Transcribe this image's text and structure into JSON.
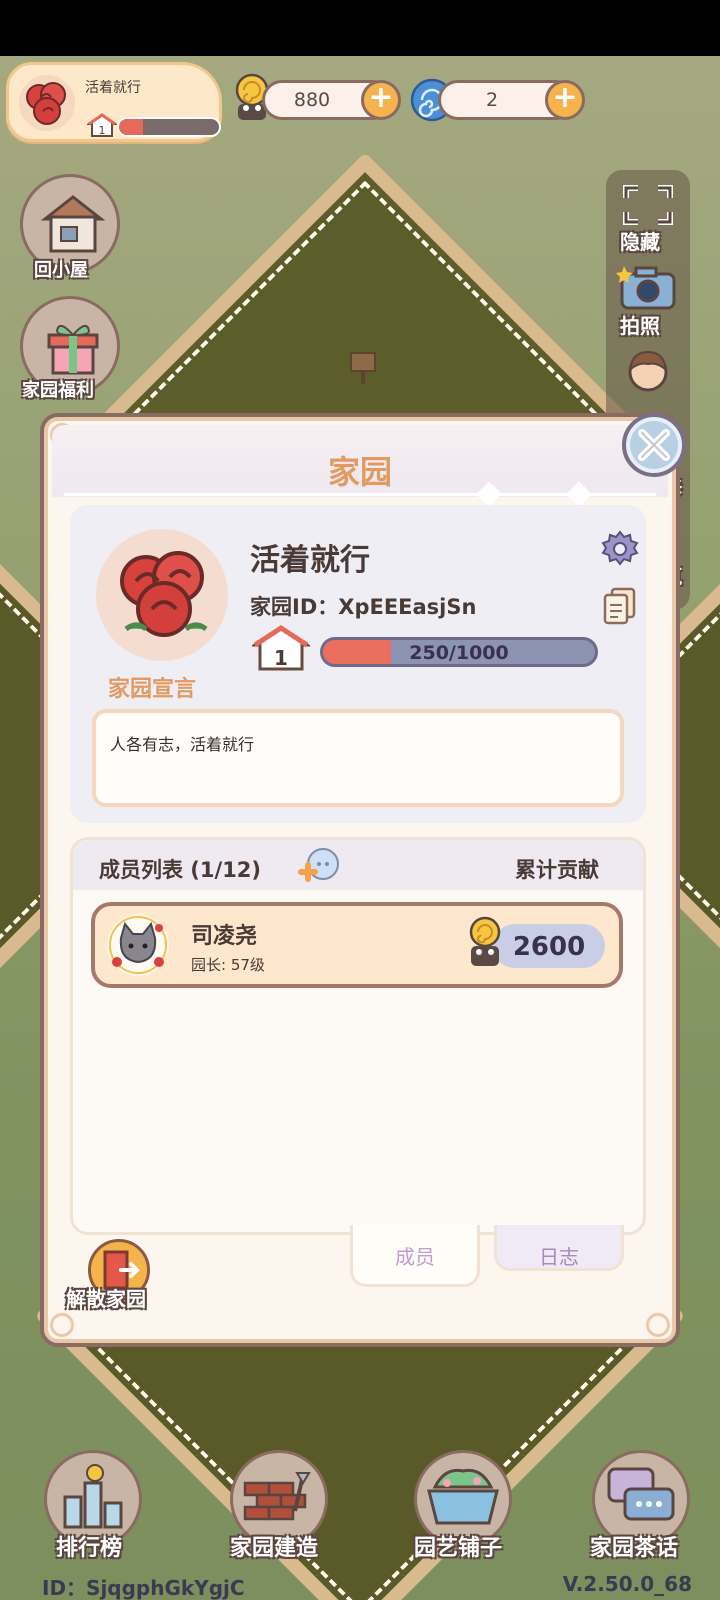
{
  "header": {
    "garden_name": "活着就行",
    "garden_level": "1",
    "garden_level_progress": 0.24,
    "snail_currency": "880",
    "spiral_currency": "2"
  },
  "left_buttons": [
    {
      "label": "回小屋",
      "icon": "house-icon"
    },
    {
      "label": "家园福利",
      "icon": "gift-icon"
    }
  ],
  "right_sidebar": [
    {
      "label": "隐藏",
      "icon": "fullscreen-icon"
    },
    {
      "label": "拍照",
      "icon": "camera-icon"
    },
    {
      "label": "修",
      "icon": "character-icon"
    },
    {
      "label": "筑",
      "icon": "build-icon"
    }
  ],
  "modal": {
    "title": "家园",
    "garden_name": "活着就行",
    "garden_id_label": "家园ID：",
    "garden_id": "XpEEEasjSn",
    "level": "1",
    "xp_text": "250/1000",
    "xp_progress": 0.25,
    "declaration_label": "家园宣言",
    "declaration_text": "人各有志，活着就行",
    "members_title": "成员列表 (1/12)",
    "contribution_header": "累计贡献",
    "members": [
      {
        "name": "司凌尧",
        "role": "园长: 57级",
        "contribution": "2600"
      }
    ],
    "tabs": [
      {
        "label": "成员",
        "active": true
      },
      {
        "label": "日志",
        "active": false
      }
    ],
    "disband_label": "解散家园"
  },
  "bottom_nav": [
    {
      "label": "排行榜",
      "icon": "leaderboard-icon"
    },
    {
      "label": "家园建造",
      "icon": "bricks-icon"
    },
    {
      "label": "园艺铺子",
      "icon": "flower-pot-icon"
    },
    {
      "label": "家园茶话",
      "icon": "chat-icon"
    }
  ],
  "footer": {
    "user_id": "ID：SjqgphGkYgjC",
    "version": "V.2.50.0_68"
  },
  "colors": {
    "accent_orange": "#e29a63",
    "xp_fill": "#ea6f5e",
    "border_brown": "#8a6b62",
    "plus_button": "#f5b24d"
  }
}
